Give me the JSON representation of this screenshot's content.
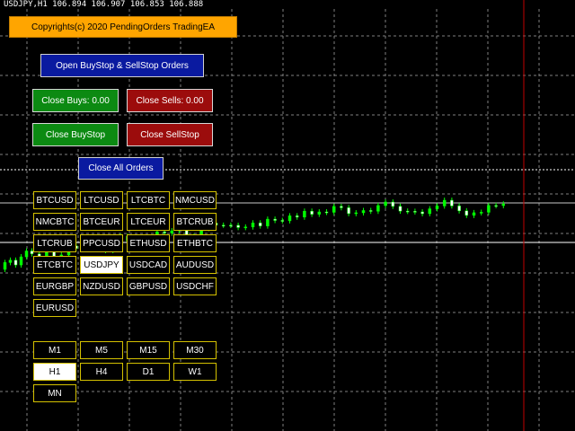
{
  "ticker": "USDJPY,H1  106.894 106.907 106.853 106.888",
  "copyright": "Copyrights(c) 2020 PendingOrders TradingEA",
  "buttons": {
    "open": "Open BuyStop & SellStop Orders",
    "close_buys": "Close Buys: 0.00",
    "close_sells": "Close Sells: 0.00",
    "close_buystop": "Close BuyStop",
    "close_sellstop": "Close SellStop",
    "close_all": "Close All Orders"
  },
  "symbols": [
    "BTCUSD",
    "LTCUSD",
    "LTCBTC",
    "NMCUSD",
    "NMCBTC",
    "BTCEUR",
    "LTCEUR",
    "BTCRUB",
    "LTCRUB",
    "PPCUSD",
    "ETHUSD",
    "ETHBTC",
    "ETCBTC",
    "USDJPY",
    "USDCAD",
    "AUDUSD",
    "EURGBP",
    "NZDUSD",
    "GBPUSD",
    "USDCHF",
    "EURUSD"
  ],
  "active_symbol": "USDJPY",
  "timeframes": [
    "M1",
    "M5",
    "M15",
    "M30",
    "H1",
    "H4",
    "D1",
    "W1",
    "MN"
  ],
  "active_timeframe": "H1",
  "colors": {
    "bull": "#00ff00",
    "bear": "#ffffff",
    "grid": "#808080",
    "vline": "#c00000",
    "copyright_bg": "#ffa500",
    "blue_btn": "#0a1aa0",
    "green_btn": "#0c8a12",
    "red_btn": "#9c0c0c",
    "frame": "#d4c100"
  }
}
